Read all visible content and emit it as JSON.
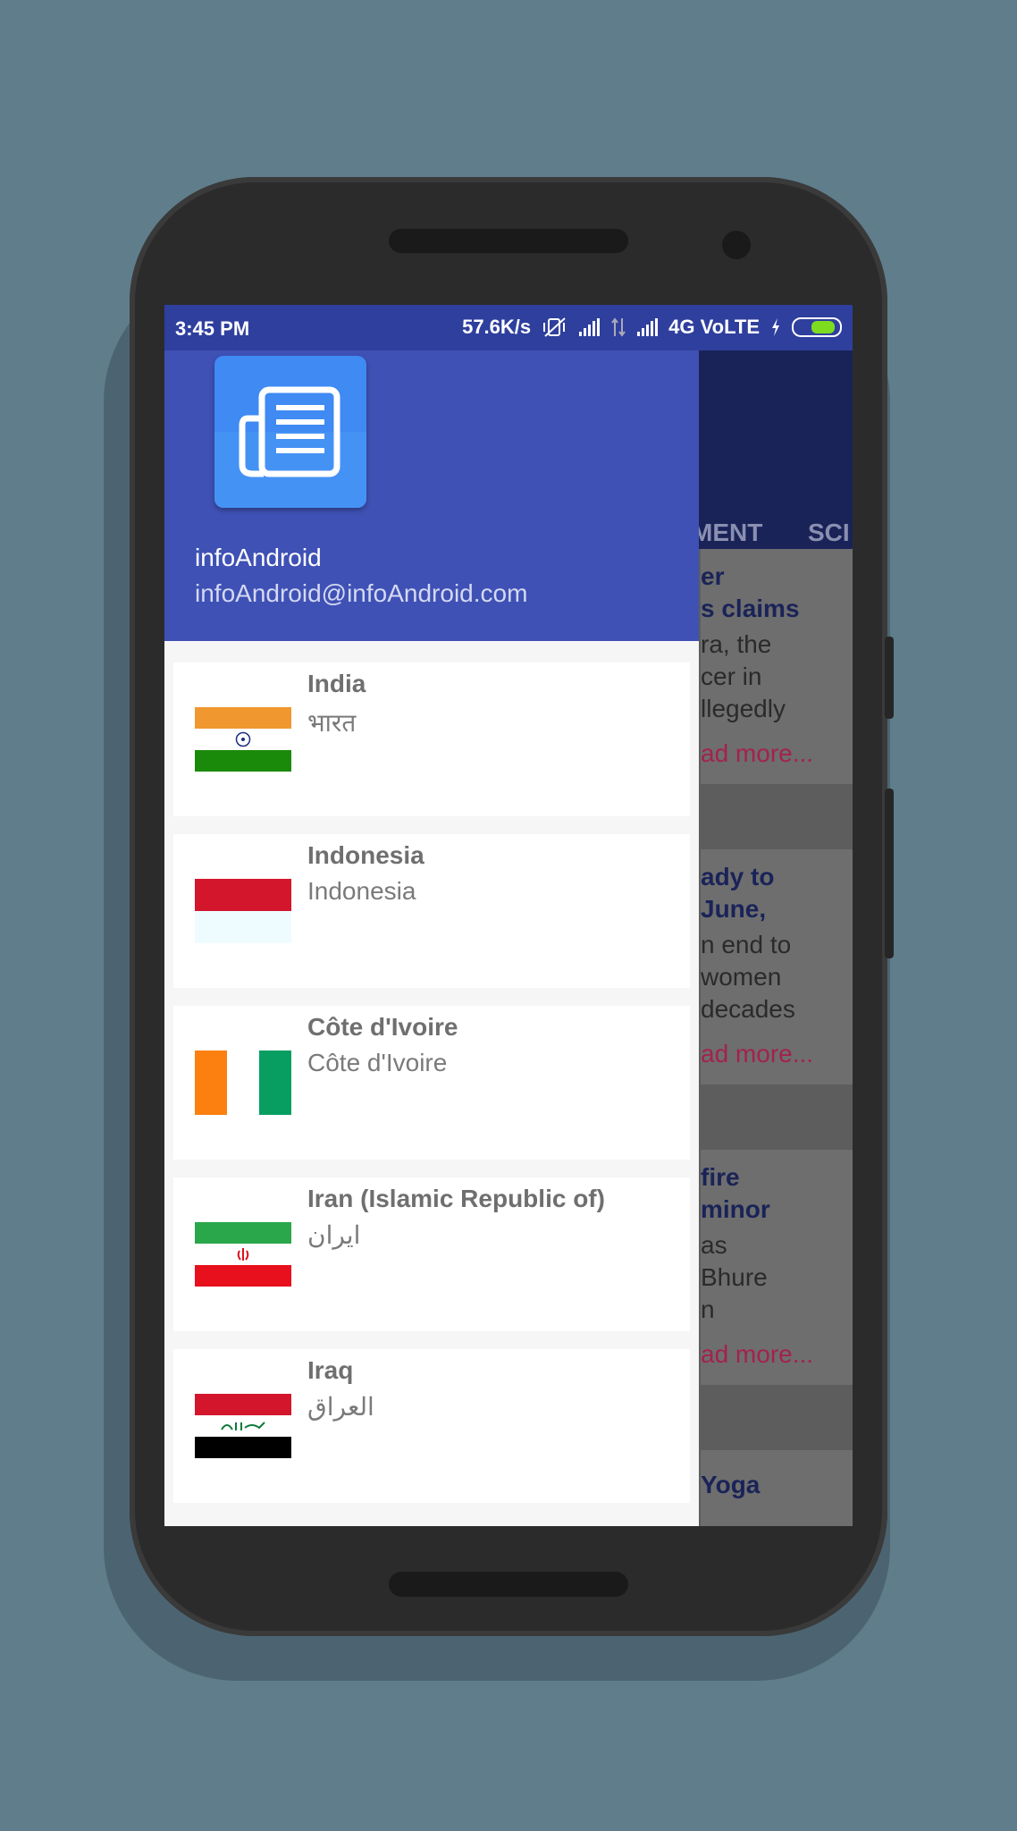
{
  "status_bar": {
    "time": "3:45 PM",
    "speed": "57.6K/s",
    "network": "4G VoLTE"
  },
  "background_app": {
    "tabs": [
      "MENT",
      "SCI"
    ],
    "cards": [
      {
        "title_lines": [
          "er",
          "s claims"
        ],
        "body_lines": [
          "ra, the",
          "cer in",
          "llegedly"
        ],
        "read_more": "ad more..."
      },
      {
        "title_lines": [
          "ady to",
          "June,"
        ],
        "body_lines": [
          "n end to",
          "women",
          "decades"
        ],
        "read_more": "ad more..."
      },
      {
        "title_lines": [
          "fire",
          "minor"
        ],
        "body_lines": [
          "as",
          "Bhure",
          "n"
        ],
        "read_more": "ad more..."
      },
      {
        "title_lines": [
          "Yoga"
        ],
        "body_lines": [],
        "read_more": ""
      }
    ]
  },
  "drawer": {
    "app_icon": "newspaper-icon",
    "user_name": "infoAndroid",
    "user_email": "infoAndroid@infoAndroid.com",
    "countries": [
      {
        "name": "India",
        "native": "भारत",
        "flag": "india-flag-icon"
      },
      {
        "name": "Indonesia",
        "native": "Indonesia",
        "flag": "indonesia-flag-icon"
      },
      {
        "name": "Côte d'Ivoire",
        "native": "Côte d'Ivoire",
        "flag": "ivory-coast-flag-icon"
      },
      {
        "name": "Iran (Islamic Republic of)",
        "native": "ایران",
        "flag": "iran-flag-icon"
      },
      {
        "name": "Iraq",
        "native": "العراق",
        "flag": "iraq-flag-icon"
      }
    ]
  },
  "colors": {
    "status_bar": "#2f3f9e",
    "drawer_header": "#3f51b5",
    "toolbar": "#1a2358",
    "read_more": "#a3224d"
  }
}
